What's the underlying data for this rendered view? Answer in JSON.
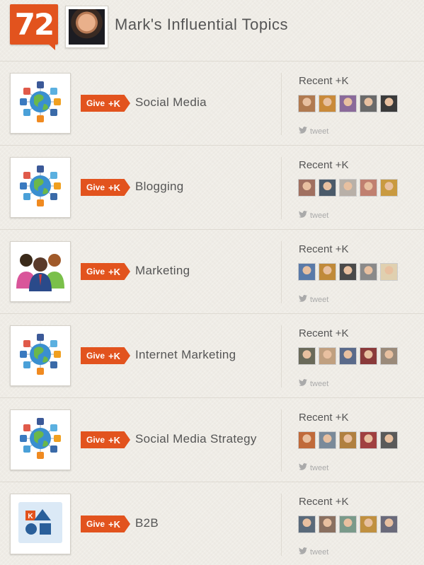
{
  "header": {
    "score": "72",
    "title": "Mark's Influential Topics"
  },
  "labels": {
    "give": "Give",
    "plus_k": "+K",
    "recent": "Recent +K",
    "tweet": "tweet"
  },
  "colors": {
    "accent": "#e2531e",
    "background": "#efece6",
    "text": "#555555"
  },
  "topics": [
    {
      "name": "Social Media",
      "icon": "social-network-globe-icon",
      "avatars": [
        "#b07a50",
        "#c98a3a",
        "#8a6a9a",
        "#6a6a6a",
        "#3a3a3a"
      ]
    },
    {
      "name": "Blogging",
      "icon": "social-network-globe-icon",
      "avatars": [
        "#a07060",
        "#4a5a6a",
        "#b8b0a8",
        "#c08070",
        "#c99a40"
      ]
    },
    {
      "name": "Marketing",
      "icon": "people-group-icon",
      "avatars": [
        "#5a7aa8",
        "#c08a3a",
        "#4a4a4a",
        "#8a8a8a",
        "#e0d0b0"
      ]
    },
    {
      "name": "Internet Marketing",
      "icon": "social-network-globe-icon",
      "avatars": [
        "#6a6a5a",
        "#c0a080",
        "#5a6a8a",
        "#8a3a3a",
        "#9a8a7a"
      ]
    },
    {
      "name": "Social Media Strategy",
      "icon": "social-network-globe-icon",
      "avatars": [
        "#c06a3a",
        "#7a8a9a",
        "#b08040",
        "#a04040",
        "#5a5a5a"
      ]
    },
    {
      "name": "B2B",
      "icon": "klout-shapes-icon",
      "avatars": [
        "#5a6a7a",
        "#8a7060",
        "#7a9a8a",
        "#c09040",
        "#6a6a7a"
      ]
    }
  ]
}
